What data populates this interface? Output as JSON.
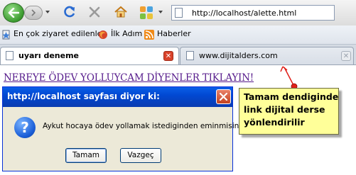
{
  "browser": {
    "address_url": "http://localhost/alette.html"
  },
  "bookmarks": {
    "items": [
      {
        "label": "En çok ziyaret edilenler",
        "icon": "bookmark-star-icon"
      },
      {
        "label": "İlk Adım",
        "icon": "firefox-icon"
      },
      {
        "label": "Haberler",
        "icon": "rss-feed-icon"
      }
    ]
  },
  "tabs": [
    {
      "title": "uyarı deneme",
      "active": true
    },
    {
      "title": "www.dijitalders.com",
      "active": false
    }
  ],
  "page": {
    "link_text": "NEREYE ÖDEV YOLLUYCAM DİYENLER TIKLAYIN!"
  },
  "dialog": {
    "title": "http://localhost sayfası diyor ki:",
    "message": "Aykut hocaya ödev yollamak istediginden eminmisin",
    "ok_label": "Tamam",
    "cancel_label": "Vazgeç",
    "icon": "question-icon"
  },
  "callout": {
    "text": "Tamam dendiginde\nlink dijital derse\nyönlendirilir"
  },
  "colors": {
    "dialog_title_blue": "#0148d2",
    "link_visited": "#551a8b",
    "callout_bg": "#ffff99",
    "tab_close_red": "#d9432b",
    "annotation_red": "#e0201a"
  }
}
